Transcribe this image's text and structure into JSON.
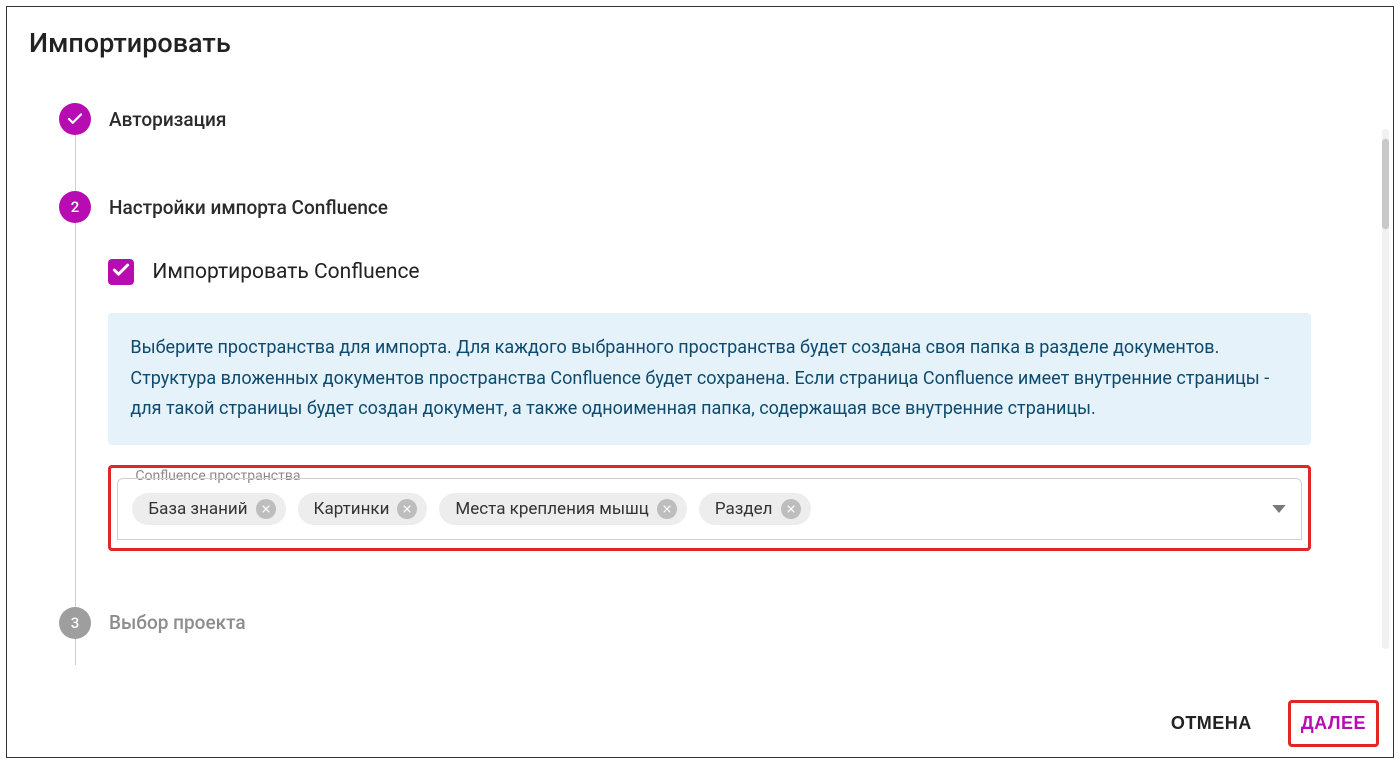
{
  "dialog": {
    "title": "Импортировать"
  },
  "stepper": {
    "step1": {
      "label": "Авторизация"
    },
    "step2": {
      "number": "2",
      "label": "Настройки импорта Confluence",
      "checkbox_label": "Импортировать Confluence",
      "info_text": "Выберите пространства для импорта. Для каждого выбранного пространства будет создана своя папка в разделе документов. Структура вложенных документов пространства Confluence будет сохранена. Если страница Confluence имеет внутренние страницы - для такой страницы будет создан документ, а также одноименная папка, содержащая все внутренние страницы.",
      "spaces_field": {
        "legend": "Confluence пространства",
        "chips": [
          "База знаний",
          "Картинки",
          "Места крепления мышц",
          "Раздел"
        ]
      }
    },
    "step3": {
      "number": "3",
      "label": "Выбор проекта"
    }
  },
  "footer": {
    "cancel": "ОТМЕНА",
    "next": "ДАЛЕЕ"
  },
  "colors": {
    "accent": "#b70cb1",
    "highlight": "#e02626",
    "info_bg": "#e5f2fa",
    "info_text": "#0d4a6e"
  }
}
